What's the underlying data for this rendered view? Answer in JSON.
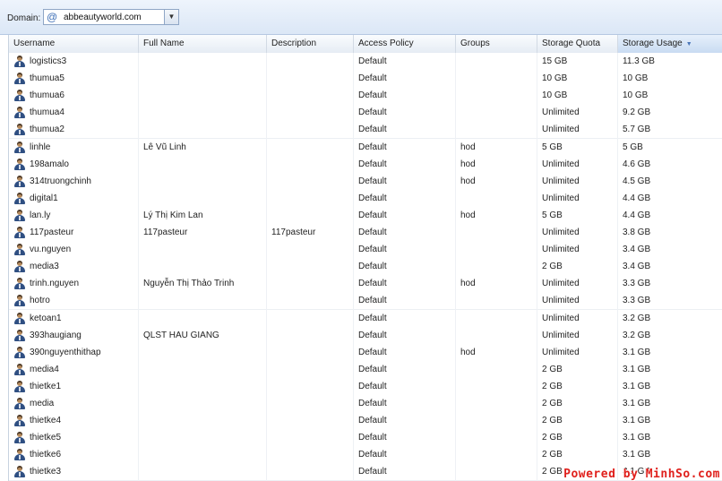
{
  "toolbar": {
    "domain_label": "Domain:",
    "domain_value": "abbeautyworld.com",
    "domain_icon": "at-sign-icon"
  },
  "columns": [
    {
      "key": "username",
      "label": "Username"
    },
    {
      "key": "fullname",
      "label": "Full Name"
    },
    {
      "key": "description",
      "label": "Description"
    },
    {
      "key": "policy",
      "label": "Access Policy"
    },
    {
      "key": "groups",
      "label": "Groups"
    },
    {
      "key": "quota",
      "label": "Storage Quota"
    },
    {
      "key": "usage",
      "label": "Storage Usage",
      "sorted": "descending"
    }
  ],
  "rows": [
    {
      "username": "logistics3",
      "fullname": "",
      "description": "",
      "policy": "Default",
      "groups": "",
      "quota": "15 GB",
      "usage": "11.3 GB"
    },
    {
      "username": "thumua5",
      "fullname": "",
      "description": "",
      "policy": "Default",
      "groups": "",
      "quota": "10 GB",
      "usage": "10 GB"
    },
    {
      "username": "thumua6",
      "fullname": "",
      "description": "",
      "policy": "Default",
      "groups": "",
      "quota": "10 GB",
      "usage": "10 GB"
    },
    {
      "username": "thumua4",
      "fullname": "",
      "description": "",
      "policy": "Default",
      "groups": "",
      "quota": "Unlimited",
      "usage": "9.2 GB"
    },
    {
      "username": "thumua2",
      "fullname": "",
      "description": "",
      "policy": "Default",
      "groups": "",
      "quota": "Unlimited",
      "usage": "5.7 GB"
    },
    {
      "username": "linhle",
      "fullname": "Lê Vũ Linh",
      "description": "",
      "policy": "Default",
      "groups": "hod",
      "quota": "5 GB",
      "usage": "5 GB"
    },
    {
      "username": "198amalo",
      "fullname": "",
      "description": "",
      "policy": "Default",
      "groups": "hod",
      "quota": "Unlimited",
      "usage": "4.6 GB"
    },
    {
      "username": "314truongchinh",
      "fullname": "",
      "description": "",
      "policy": "Default",
      "groups": "hod",
      "quota": "Unlimited",
      "usage": "4.5 GB"
    },
    {
      "username": "digital1",
      "fullname": "",
      "description": "",
      "policy": "Default",
      "groups": "",
      "quota": "Unlimited",
      "usage": "4.4 GB"
    },
    {
      "username": "lan.ly",
      "fullname": "Lý Thị Kim Lan",
      "description": "",
      "policy": "Default",
      "groups": "hod",
      "quota": "5 GB",
      "usage": "4.4 GB"
    },
    {
      "username": "117pasteur",
      "fullname": "117pasteur",
      "description": "117pasteur",
      "policy": "Default",
      "groups": "",
      "quota": "Unlimited",
      "usage": "3.8 GB"
    },
    {
      "username": "vu.nguyen",
      "fullname": "",
      "description": "",
      "policy": "Default",
      "groups": "",
      "quota": "Unlimited",
      "usage": "3.4 GB"
    },
    {
      "username": "media3",
      "fullname": "",
      "description": "",
      "policy": "Default",
      "groups": "",
      "quota": "2 GB",
      "usage": "3.4 GB"
    },
    {
      "username": "trinh.nguyen",
      "fullname": "Nguyễn Thị Thảo Trinh",
      "description": "",
      "policy": "Default",
      "groups": "hod",
      "quota": "Unlimited",
      "usage": "3.3 GB"
    },
    {
      "username": "hotro",
      "fullname": "",
      "description": "",
      "policy": "Default",
      "groups": "",
      "quota": "Unlimited",
      "usage": "3.3 GB"
    },
    {
      "username": "ketoan1",
      "fullname": "",
      "description": "",
      "policy": "Default",
      "groups": "",
      "quota": "Unlimited",
      "usage": "3.2 GB"
    },
    {
      "username": "393haugiang",
      "fullname": "QLST HAU GIANG",
      "description": "",
      "policy": "Default",
      "groups": "",
      "quota": "Unlimited",
      "usage": "3.2 GB"
    },
    {
      "username": "390nguyenthithap",
      "fullname": "",
      "description": "",
      "policy": "Default",
      "groups": "hod",
      "quota": "Unlimited",
      "usage": "3.1 GB"
    },
    {
      "username": "media4",
      "fullname": "",
      "description": "",
      "policy": "Default",
      "groups": "",
      "quota": "2 GB",
      "usage": "3.1 GB"
    },
    {
      "username": "thietke1",
      "fullname": "",
      "description": "",
      "policy": "Default",
      "groups": "",
      "quota": "2 GB",
      "usage": "3.1 GB"
    },
    {
      "username": "media",
      "fullname": "",
      "description": "",
      "policy": "Default",
      "groups": "",
      "quota": "2 GB",
      "usage": "3.1 GB"
    },
    {
      "username": "thietke4",
      "fullname": "",
      "description": "",
      "policy": "Default",
      "groups": "",
      "quota": "2 GB",
      "usage": "3.1 GB"
    },
    {
      "username": "thietke5",
      "fullname": "",
      "description": "",
      "policy": "Default",
      "groups": "",
      "quota": "2 GB",
      "usage": "3.1 GB"
    },
    {
      "username": "thietke6",
      "fullname": "",
      "description": "",
      "policy": "Default",
      "groups": "",
      "quota": "2 GB",
      "usage": "3.1 GB"
    },
    {
      "username": "thietke3",
      "fullname": "",
      "description": "",
      "policy": "Default",
      "groups": "",
      "quota": "2 GB",
      "usage": "3.1 GB"
    }
  ],
  "user_icon": "user-icon",
  "watermark": "Powered by MinhSo.com"
}
